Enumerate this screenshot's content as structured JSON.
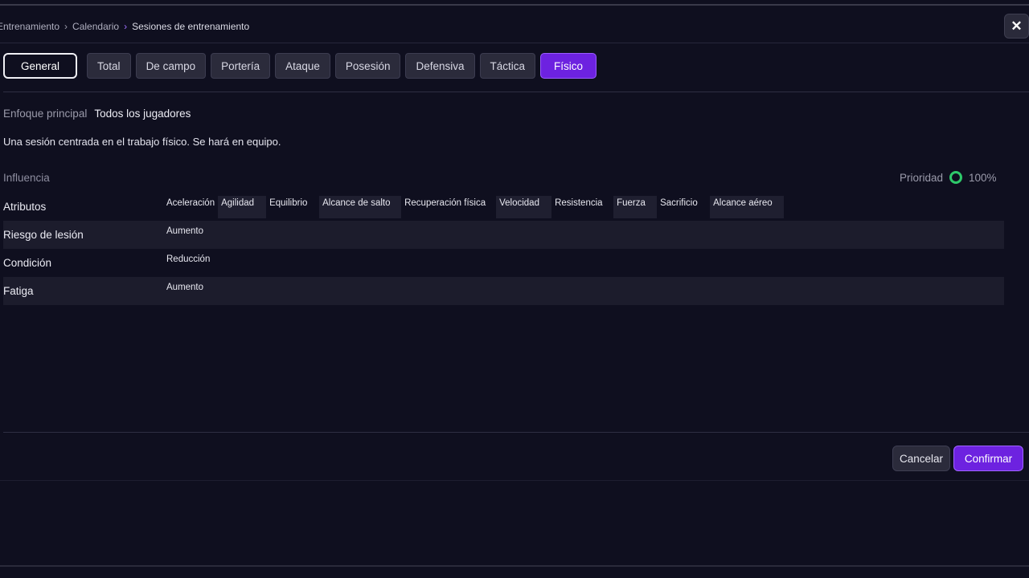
{
  "breadcrumb": {
    "items": [
      "Entrenamiento",
      "Calendario",
      "Sesiones de entrenamiento"
    ]
  },
  "close_icon": "close-icon",
  "tabs": [
    {
      "label": "General"
    },
    {
      "label": "Total"
    },
    {
      "label": "De campo"
    },
    {
      "label": "Portería"
    },
    {
      "label": "Ataque"
    },
    {
      "label": "Posesión"
    },
    {
      "label": "Defensiva"
    },
    {
      "label": "Táctica"
    },
    {
      "label": "Físico",
      "active": true
    }
  ],
  "focus": {
    "label": "Enfoque principal",
    "value": "Todos los jugadores"
  },
  "description": "Una sesión centrada en el trabajo físico. Se hará en equipo.",
  "influence": {
    "label": "Influencia"
  },
  "priority": {
    "label": "Prioridad",
    "value": "100%",
    "color": "#2ec96a"
  },
  "rows": {
    "attributes": {
      "label": "Atributos",
      "chips": [
        "Aceleración",
        "Agilidad",
        "Equilibrio",
        "Alcance de salto",
        "Recuperación física",
        "Velocidad",
        "Resistencia",
        "Fuerza",
        "Sacrificio",
        "Alcance aéreo"
      ]
    },
    "injury": {
      "label": "Riesgo de lesión",
      "value": "Aumento"
    },
    "condition": {
      "label": "Condición",
      "value": "Reducción"
    },
    "fatigue": {
      "label": "Fatiga",
      "value": "Aumento"
    }
  },
  "footer": {
    "cancel": "Cancelar",
    "confirm": "Confirmar"
  },
  "colors": {
    "accent": "#6d22e0",
    "background": "#0f0f1f"
  }
}
